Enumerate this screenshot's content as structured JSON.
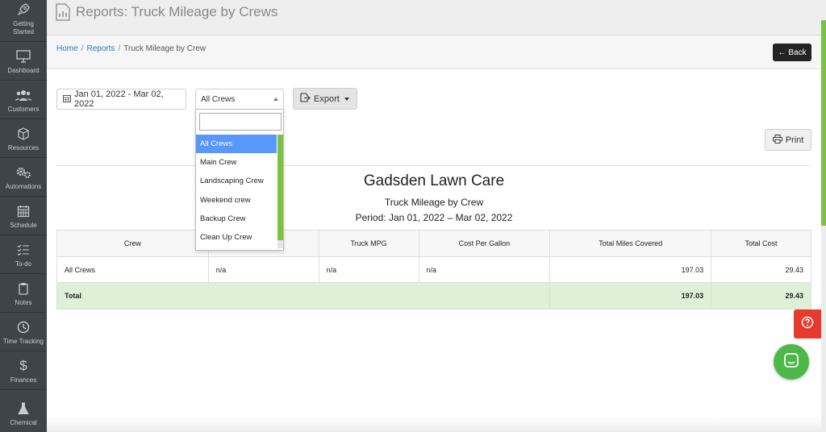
{
  "sidebar": {
    "items": [
      {
        "label": "Getting\nStarted",
        "icon": "rocket-icon"
      },
      {
        "label": "Dashboard",
        "icon": "monitor-icon"
      },
      {
        "label": "Customers",
        "icon": "users-icon"
      },
      {
        "label": "Resources",
        "icon": "box-icon"
      },
      {
        "label": "Automations",
        "icon": "gears-icon"
      },
      {
        "label": "Schedule",
        "icon": "calendar-icon"
      },
      {
        "label": "To-do",
        "icon": "checklist-icon"
      },
      {
        "label": "Notes",
        "icon": "clipboard-icon"
      },
      {
        "label": "Time Tracking",
        "icon": "clock-icon"
      },
      {
        "label": "Finances",
        "icon": "dollar-icon"
      },
      {
        "label": "Chemical",
        "icon": "flask-icon"
      }
    ]
  },
  "header": {
    "title": "Reports: Truck Mileage by Crews"
  },
  "breadcrumb": {
    "home": "Home",
    "reports": "Reports",
    "current": "Truck Mileage by Crew"
  },
  "back_label": "Back",
  "controls": {
    "date_range": "Jan 01, 2022 - Mar 02, 2022",
    "crew_selected": "All Crews",
    "export_label": "Export",
    "print_label": "Print"
  },
  "dropdown": {
    "options": [
      "All Crews",
      "Main Crew",
      "Landscaping Crew",
      "Weekend crew",
      "Backup Crew",
      "Clean Up Crew"
    ],
    "selected_index": 0
  },
  "report": {
    "company": "Gadsden Lawn Care",
    "title": "Truck Mileage by Crew",
    "period": "Period: Jan 01, 2022 – Mar 02, 2022",
    "columns": [
      "Crew",
      "",
      "Truck MPG",
      "Cost Per Gallon",
      "Total Miles Covered",
      "Total Cost"
    ],
    "rows": [
      [
        "All Crews",
        "n/a",
        "n/a",
        "n/a",
        "197.03",
        "29.43"
      ]
    ],
    "total": {
      "label": "Total",
      "miles": "197.03",
      "cost": "29.43"
    }
  },
  "colors": {
    "accent_green": "#7cc242",
    "selected_blue": "#5897fb",
    "help_red": "#e63a2f",
    "chat_green": "#4cb848"
  }
}
